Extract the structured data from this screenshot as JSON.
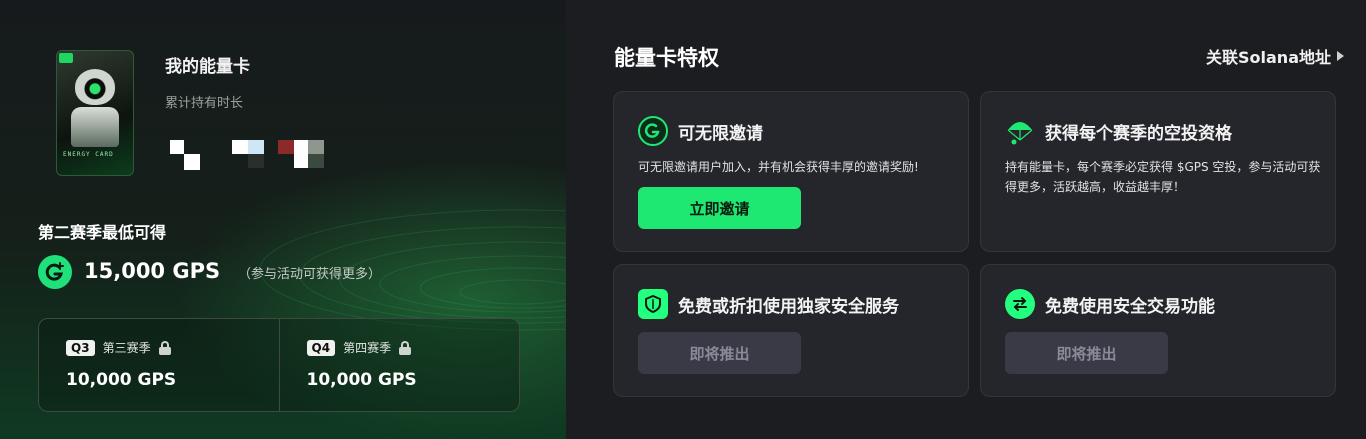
{
  "energy_card": {
    "title": "我的能量卡",
    "holding_label": "累计持有时长",
    "card_brand": "ENERGY CARD"
  },
  "season": {
    "title": "第二赛季最低可得",
    "amount": "15,000 GPS",
    "note": "（参与活动可获得更多）"
  },
  "quarters": [
    {
      "badge": "Q3",
      "name": "第三赛季",
      "value": "10,000 GPS"
    },
    {
      "badge": "Q4",
      "name": "第四赛季",
      "value": "10,000 GPS"
    }
  ],
  "privileges": {
    "title": "能量卡特权",
    "link_label": "关联Solana地址",
    "cards": [
      {
        "title": "可无限邀请",
        "desc": "可无限邀请用户加入，并有机会获得丰厚的邀请奖励!",
        "button": "立即邀请",
        "icon": "gps-logo-icon"
      },
      {
        "title": "获得每个赛季的空投资格",
        "desc": "持有能量卡，每个赛季必定获得 $GPS 空投，参与活动可获得更多，活跃越高，收益越丰厚！",
        "icon": "parachute-icon"
      },
      {
        "title": "免费或折扣使用独家安全服务",
        "button": "即将推出",
        "icon": "shield-icon"
      },
      {
        "title": "免费使用安全交易功能",
        "button": "即将推出",
        "icon": "swap-icon"
      }
    ]
  },
  "colors": {
    "accent": "#1ee872",
    "panel_bg": "#1c1d21",
    "card_bg": "#25262b",
    "disabled_button": "#3a3a46"
  }
}
